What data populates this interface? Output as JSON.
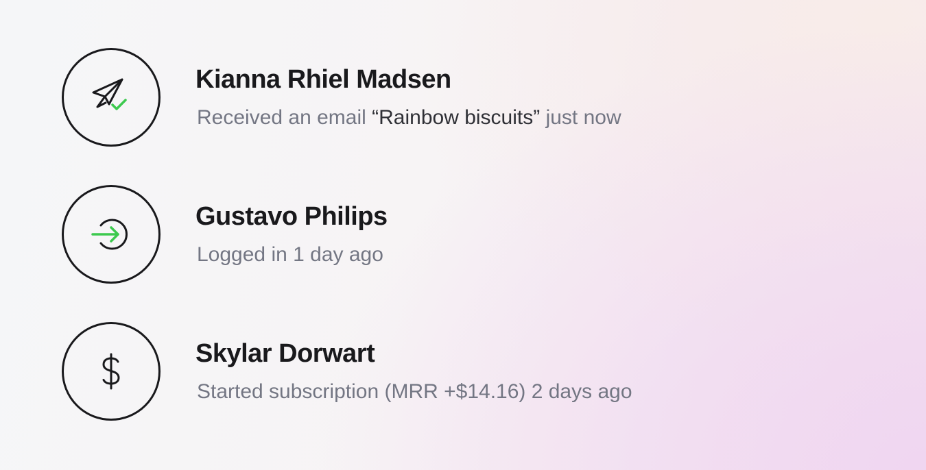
{
  "colors": {
    "text_primary": "#19191c",
    "text_secondary": "#737683",
    "accent_green": "#3cc94e"
  },
  "activity": [
    {
      "icon": "paper-plane-check-icon",
      "name": "Kianna Rhiel Madsen",
      "desc_prefix": "Received an email ",
      "desc_highlight": "“Rainbow biscuits”",
      "desc_suffix": " just now"
    },
    {
      "icon": "login-arrow-icon",
      "name": "Gustavo Philips",
      "desc": "Logged in 1 day ago"
    },
    {
      "icon": "dollar-sign-icon",
      "name": "Skylar Dorwart",
      "desc": "Started subscription (MRR +$14.16) 2 days ago"
    }
  ]
}
